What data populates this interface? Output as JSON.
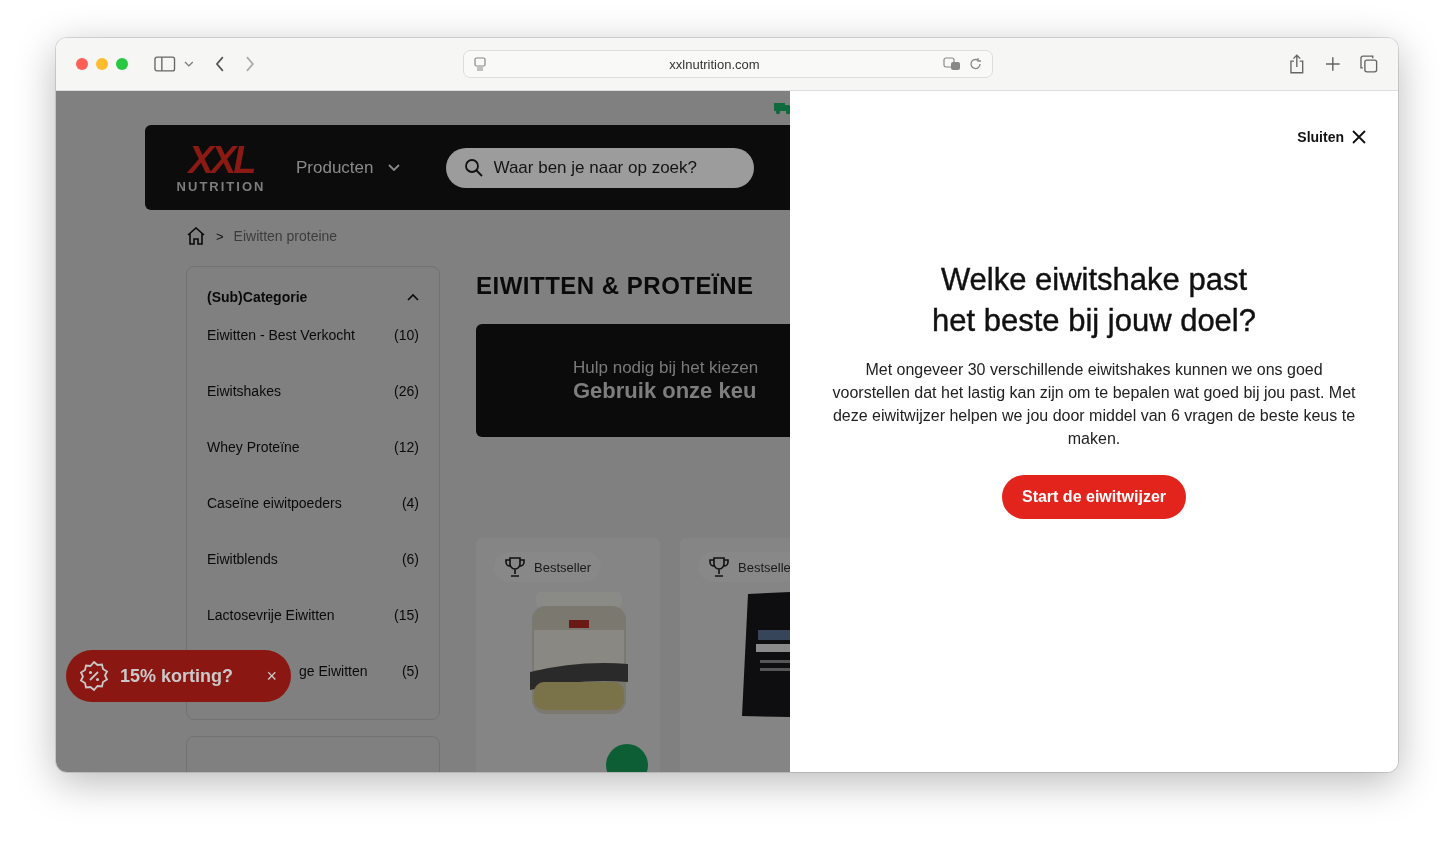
{
  "browser": {
    "url": "xxlnutrition.com"
  },
  "nav": {
    "logo_mark": "XXL",
    "logo_word": "NUTRITION",
    "menu": "Producten",
    "search_placeholder": "Waar ben je naar op zoek?"
  },
  "breadcrumb": {
    "separator": ">",
    "items": [
      "Eiwitten proteine"
    ]
  },
  "sidebar": {
    "title": "(Sub)Categorie",
    "expanded": true,
    "items": [
      {
        "label": "Eiwitten - Best Verkocht",
        "count": "(10)",
        "kind": "full"
      },
      {
        "label": "Eiwitshakes",
        "count": "(26)",
        "kind": "full"
      },
      {
        "label": "Whey Proteïne",
        "count": "(12)",
        "kind": "full"
      },
      {
        "label": "Caseïne eiwitpoeders",
        "count": "(4)",
        "kind": "full"
      },
      {
        "label": "Eiwitblends",
        "count": "(6)",
        "kind": "full"
      },
      {
        "label": "Lactosevrije Eiwitten",
        "count": "(15)",
        "kind": "full"
      },
      {
        "label": "ge Eiwitten",
        "count": "(5)",
        "kind": "covered"
      }
    ]
  },
  "heading": "EIWITTEN & PROTEÏNE",
  "banner": {
    "line_1": "Hulp nodig bij het kiezen",
    "line_2": "Gebruik onze keu"
  },
  "products": [
    {
      "badge": "Bestseller",
      "kind": "picture"
    },
    {
      "badge": "Bestselle",
      "kind": "picture"
    }
  ],
  "promo": {
    "label": "15% korting?",
    "close": "×"
  },
  "modal": {
    "close_label": "Sluiten",
    "title_lines": [
      "Welke eiwitshake past",
      "het beste bij jouw doel?"
    ],
    "body": "Met ongeveer 30 verschillende eiwitshakes kunnen we ons goed voorstellen dat het lastig kan zijn om te bepalen wat goed bij jou past. Met deze eiwitwijzer helpen we jou door middel van 6 vragen de beste keus te maken.",
    "button": "Start de eiwitwijzer"
  }
}
